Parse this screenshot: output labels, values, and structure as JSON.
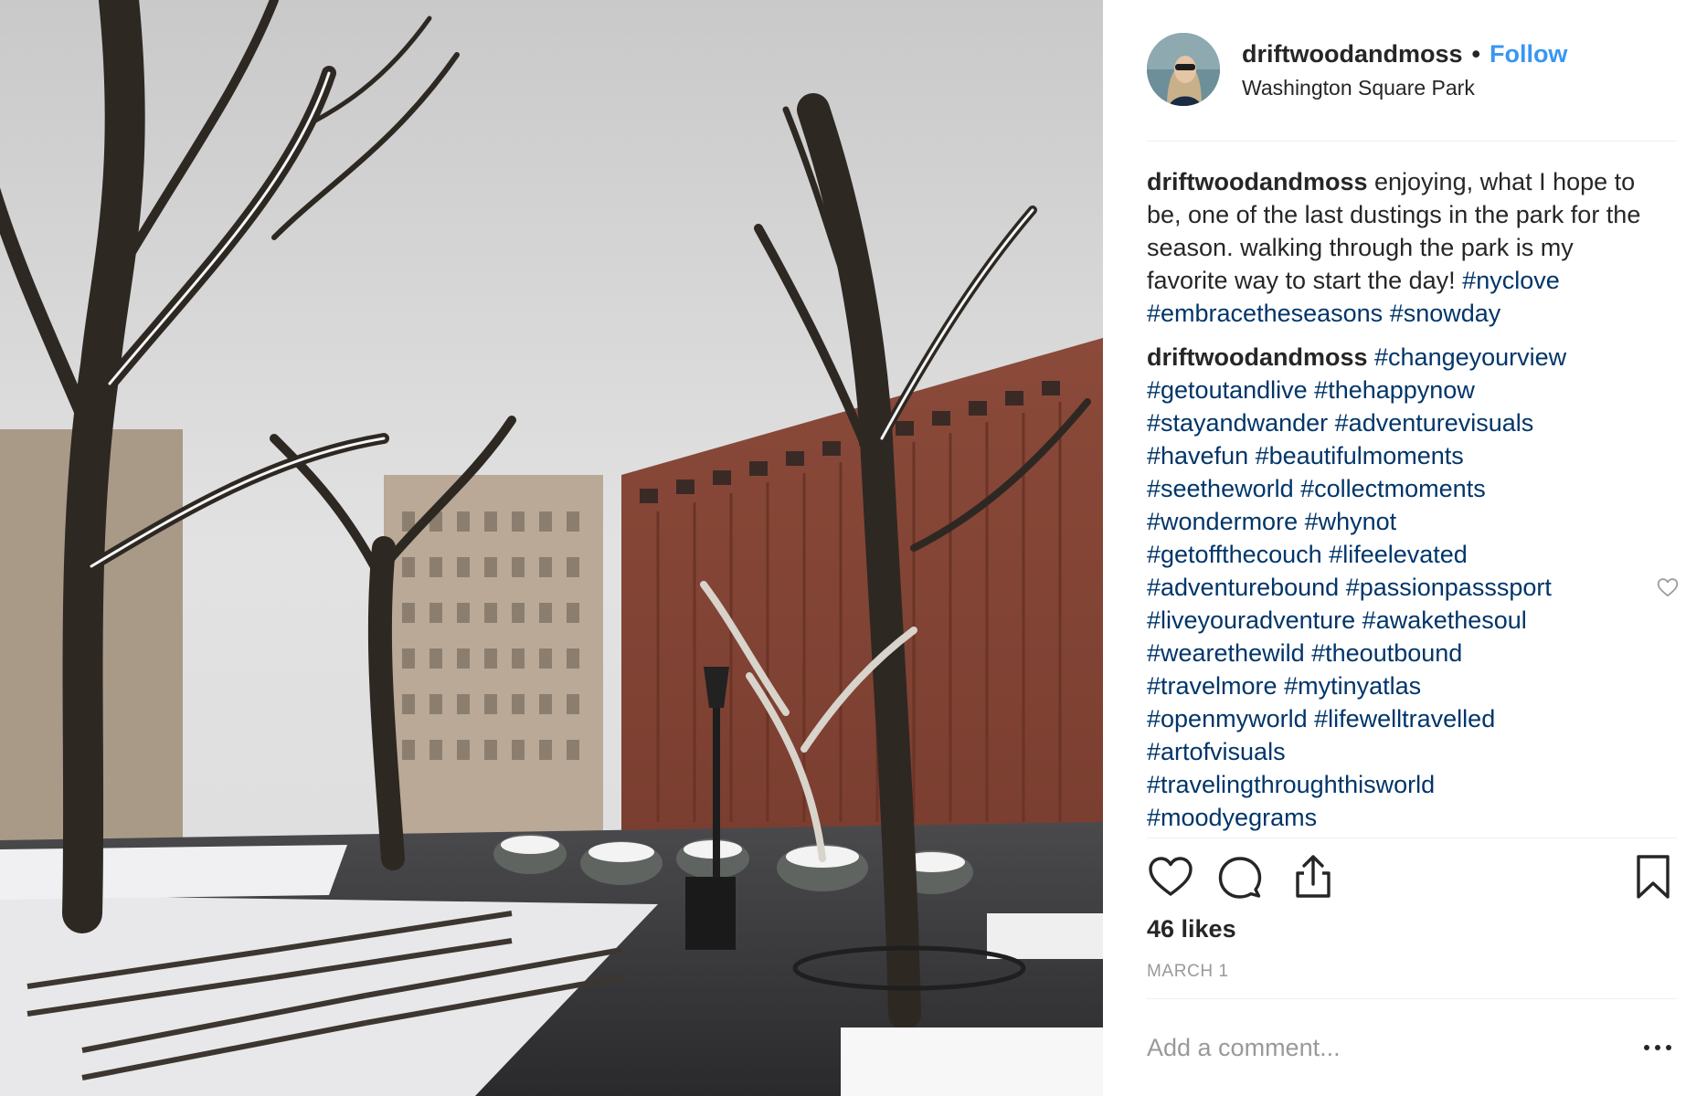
{
  "post": {
    "username": "driftwoodandmoss",
    "separator": "•",
    "follow_label": "Follow",
    "location": "Washington Square Park",
    "likes": "46 likes",
    "date": "MARCH 1",
    "add_comment_placeholder": "Add a comment..."
  },
  "comments": [
    {
      "username": "driftwoodandmoss",
      "text": " enjoying, what I hope to be, one of the last dustings in the park for the season. walking through the park is my favorite way to start the day! ",
      "hashtags": [
        "#nyclove",
        "#embracetheseasons",
        "#snowday"
      ]
    },
    {
      "username": "driftwoodandmoss",
      "hashtags": [
        "#changeyourview",
        "#getoutandlive",
        "#thehappynow",
        "#stayandwander",
        "#adventurevisuals",
        "#havefun",
        "#beautifulmoments",
        "#seetheworld",
        "#collectmoments",
        "#wondermore",
        "#whynot",
        "#getoffthecouch",
        "#lifeelevated",
        "#adventurebound",
        "#passionpasssport",
        "#liveyouradventure",
        "#awakethesoul",
        "#wearethewild",
        "#theoutbound",
        "#travelmore",
        "#mytinyatlas",
        "#openmyworld",
        "#lifewelltravelled",
        "#artofvisuals",
        "#travelingthroughthisworld",
        "#moodyegrams"
      ]
    }
  ],
  "icons": {
    "like": "heart-icon",
    "comment": "speech-bubble-icon",
    "share": "share-icon",
    "save": "bookmark-icon",
    "more": "more-options-icon",
    "comment_like": "heart-outline-icon"
  },
  "colors": {
    "follow": "#3897f0",
    "hashtag": "#003569",
    "text": "#262626",
    "muted": "#999999",
    "divider": "#efefef"
  }
}
